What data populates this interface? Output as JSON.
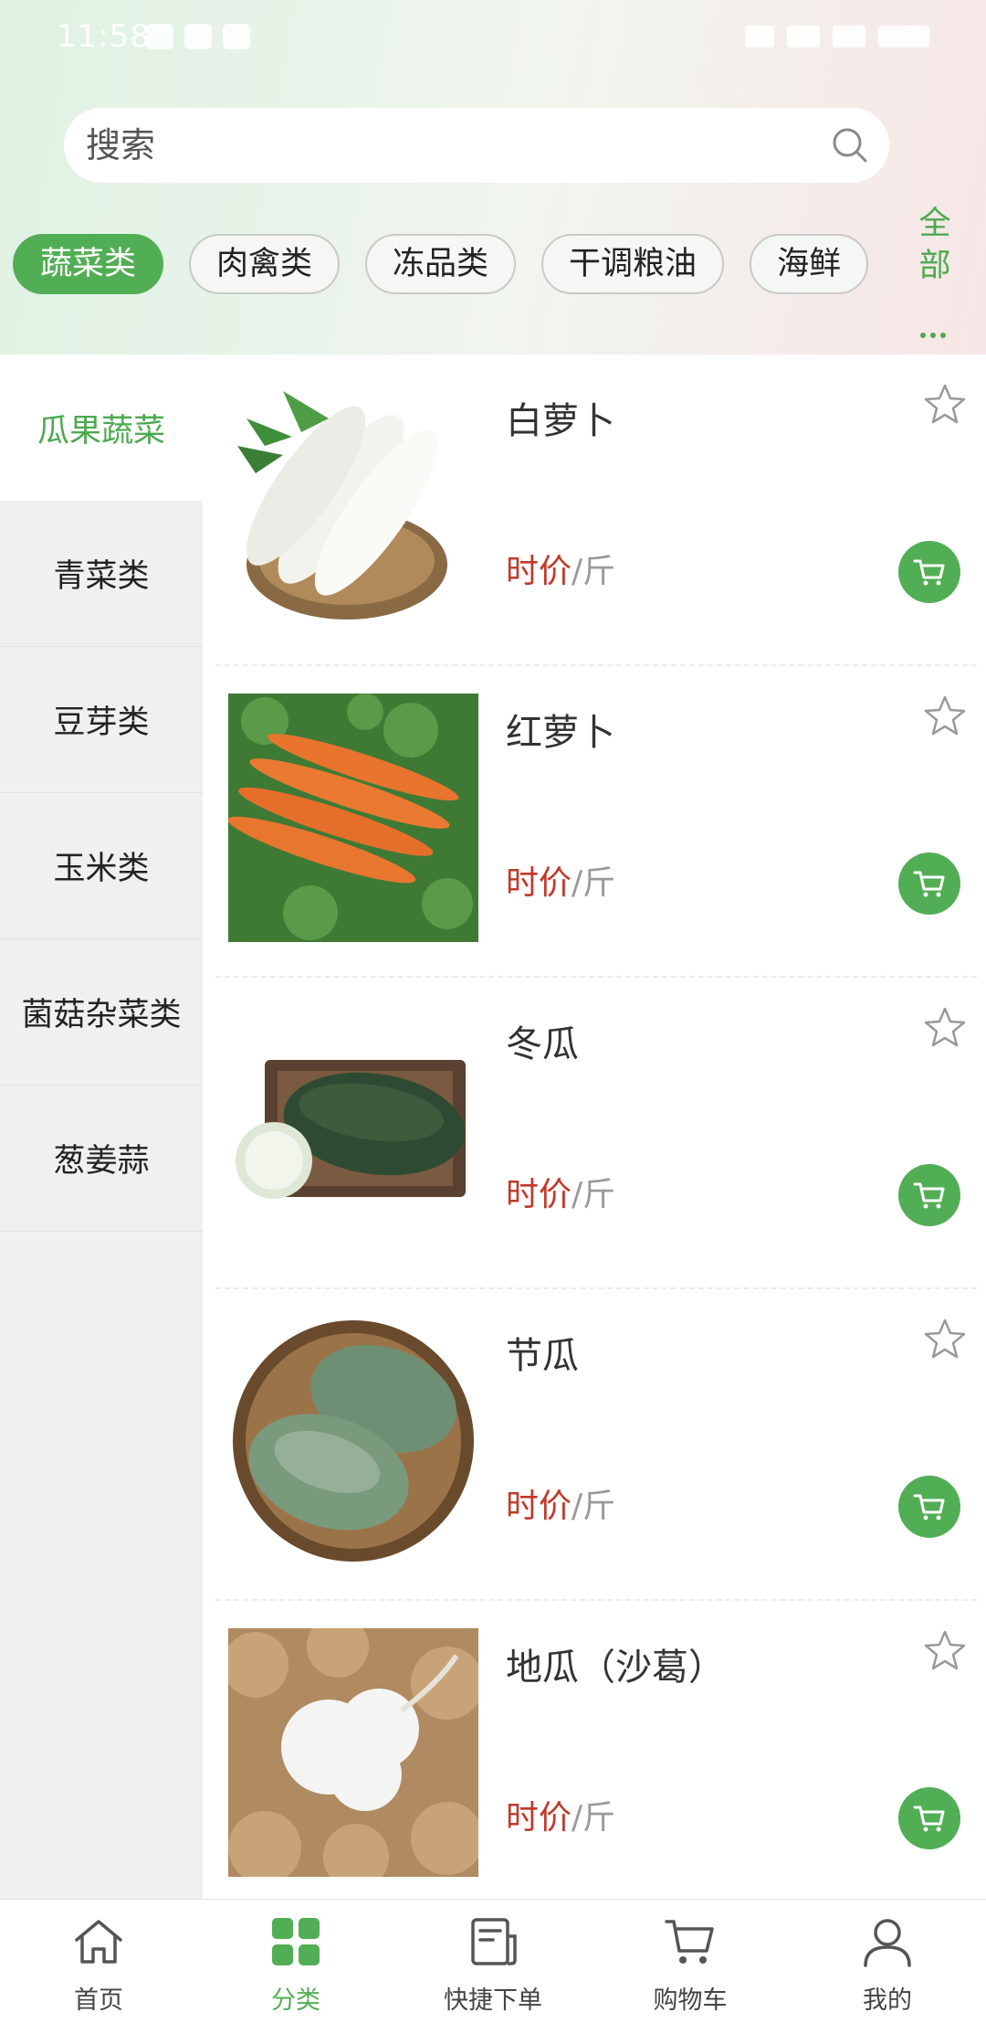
{
  "status_bar": {
    "time": "11:58"
  },
  "search": {
    "placeholder": "搜索"
  },
  "category_tabs": [
    "蔬菜类",
    "肉禽类",
    "冻品类",
    "干调粮油",
    "海鲜"
  ],
  "category_all": {
    "line1": "全",
    "line2": "部"
  },
  "sidebar": {
    "items": [
      "瓜果蔬菜",
      "青菜类",
      "豆芽类",
      "玉米类",
      "菌菇杂菜类",
      "葱姜蒜"
    ],
    "active_index": 0
  },
  "products": [
    {
      "name": "白萝卜",
      "price_label": "时价",
      "unit": "/斤",
      "image": "white-radish"
    },
    {
      "name": "红萝卜",
      "price_label": "时价",
      "unit": "/斤",
      "image": "carrot"
    },
    {
      "name": "冬瓜",
      "price_label": "时价",
      "unit": "/斤",
      "image": "winter-melon"
    },
    {
      "name": "节瓜",
      "price_label": "时价",
      "unit": "/斤",
      "image": "hairy-gourd"
    },
    {
      "name": "地瓜（沙葛）",
      "price_label": "时价",
      "unit": "/斤",
      "image": "jicama"
    }
  ],
  "bottom_nav": {
    "items": [
      {
        "label": "首页",
        "icon": "home-icon"
      },
      {
        "label": "分类",
        "icon": "category-grid-icon"
      },
      {
        "label": "快捷下单",
        "icon": "quick-order-icon"
      },
      {
        "label": "购物车",
        "icon": "cart-icon"
      },
      {
        "label": "我的",
        "icon": "user-icon"
      }
    ],
    "active_index": 1
  },
  "colors": {
    "accent": "#52ae55",
    "price": "#c0392b",
    "sidebar_bg": "#f0f0f0"
  }
}
